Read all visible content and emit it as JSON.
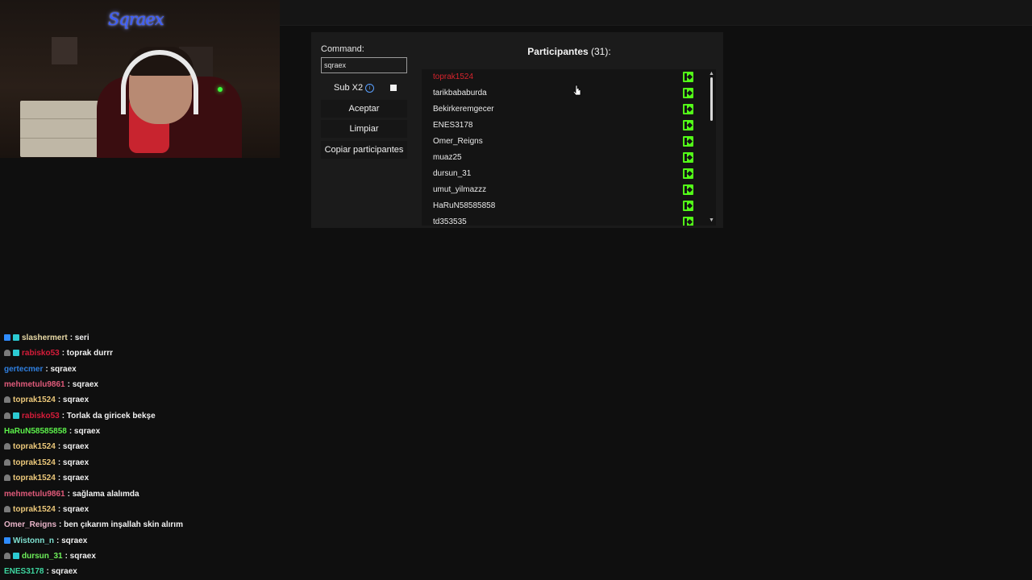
{
  "stream": {
    "logo_text": "Sqraex"
  },
  "giveaway": {
    "command_label": "Command:",
    "command_value": "sqraex",
    "sub_label": "Sub X2",
    "accept_label": "Aceptar",
    "clear_label": "Limpiar",
    "copy_label": "Copiar participantes",
    "participants_title": "Participantes",
    "participants_count": "(31):",
    "participants": [
      "toprak1524",
      "tarikbababurda",
      "Bekirkeremgecer",
      "ENES3178",
      "Omer_Reigns",
      "muaz25",
      "dursun_31",
      "umut_yilmazzz",
      "HaRuN58585858",
      "td353535"
    ],
    "platform_icon": "kick-icon",
    "colors": {
      "accent_green": "#53fc18",
      "winner_red": "#d7232c"
    }
  },
  "chat": {
    "messages": [
      {
        "user": "slashermert",
        "text": ": seri",
        "color": "#e8d9a6",
        "badges": [
          "b-blue",
          "b-cyan"
        ]
      },
      {
        "user": "rabisko53",
        "text": ": toprak durrr",
        "color": "#d71c3a",
        "badges": [
          "b-gray",
          "b-cyan"
        ]
      },
      {
        "user": "gertecmer",
        "text": ": sqraex",
        "color": "#2f7fe0",
        "badges": []
      },
      {
        "user": "mehmetulu9861",
        "text": ": sqraex",
        "color": "#e05a7a",
        "badges": []
      },
      {
        "user": "toprak1524",
        "text": ": sqraex",
        "color": "#ecc87a",
        "badges": [
          "b-gray"
        ]
      },
      {
        "user": "rabisko53",
        "text": ": Torlak da giricek bekşe",
        "color": "#d71c3a",
        "badges": [
          "b-gray",
          "b-cyan"
        ]
      },
      {
        "user": "HaRuN58585858",
        "text": ": sqraex",
        "color": "#5cf04a",
        "badges": []
      },
      {
        "user": "toprak1524",
        "text": ": sqraex",
        "color": "#ecc87a",
        "badges": [
          "b-gray"
        ]
      },
      {
        "user": "toprak1524",
        "text": ": sqraex",
        "color": "#ecc87a",
        "badges": [
          "b-gray"
        ]
      },
      {
        "user": "toprak1524",
        "text": ": sqraex",
        "color": "#ecc87a",
        "badges": [
          "b-gray"
        ]
      },
      {
        "user": "mehmetulu9861",
        "text": ": sağlama alalımda",
        "color": "#e05a7a",
        "badges": []
      },
      {
        "user": "toprak1524",
        "text": ": sqraex",
        "color": "#ecc87a",
        "badges": [
          "b-gray"
        ]
      },
      {
        "user": "Omer_Reigns",
        "text": ": ben çıkarım inşallah skin alırım",
        "color": "#e8b4c8",
        "badges": []
      },
      {
        "user": "Wistonn_n",
        "text": ": sqraex",
        "color": "#7ee0d0",
        "badges": [
          "b-blue"
        ]
      },
      {
        "user": "dursun_31",
        "text": ": sqraex",
        "color": "#6ef05a",
        "badges": [
          "b-gray",
          "b-cyan"
        ]
      },
      {
        "user": "ENES3178",
        "text": ": sqraex",
        "color": "#3ed6a0",
        "badges": []
      }
    ]
  }
}
